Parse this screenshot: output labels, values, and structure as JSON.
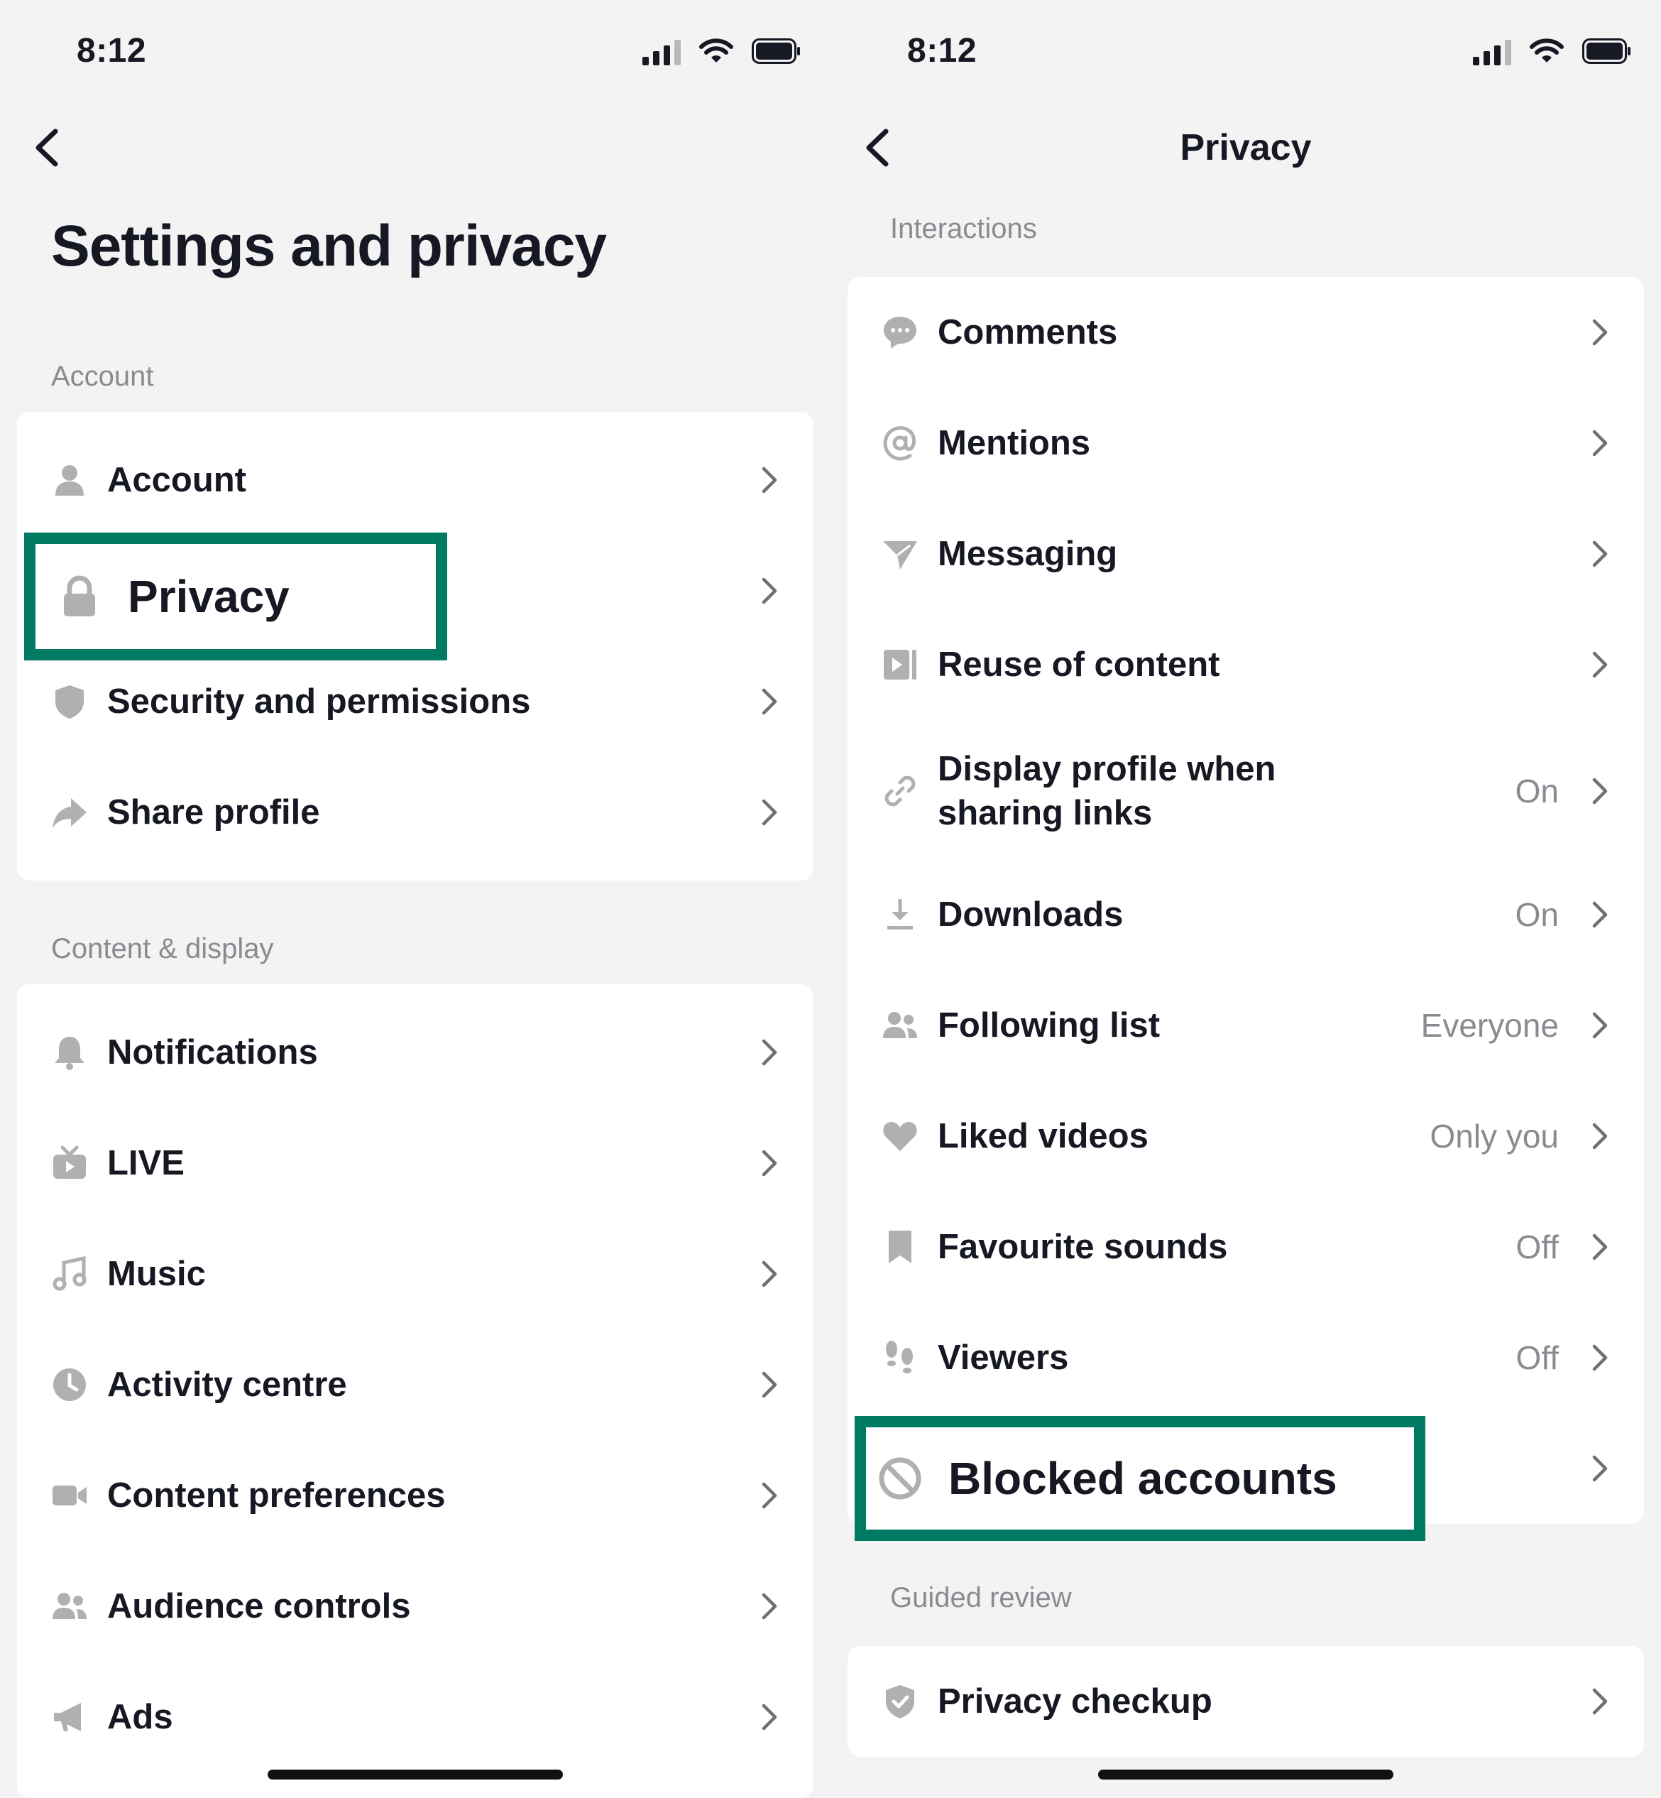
{
  "left_screen": {
    "status": {
      "time": "8:12"
    },
    "title": "Settings and privacy",
    "sections": [
      {
        "label": "Account",
        "items": [
          {
            "label": "Account",
            "icon": "person-icon"
          },
          {
            "label": "Privacy",
            "icon": "lock-icon"
          },
          {
            "label": "Security and permissions",
            "icon": "shield-icon"
          },
          {
            "label": "Share profile",
            "icon": "share-arrow-icon"
          }
        ]
      },
      {
        "label": "Content & display",
        "items": [
          {
            "label": "Notifications",
            "icon": "bell-icon"
          },
          {
            "label": "LIVE",
            "icon": "tv-icon"
          },
          {
            "label": "Music",
            "icon": "music-note-icon"
          },
          {
            "label": "Activity centre",
            "icon": "clock-icon"
          },
          {
            "label": "Content preferences",
            "icon": "video-camera-icon"
          },
          {
            "label": "Audience controls",
            "icon": "people-icon"
          },
          {
            "label": "Ads",
            "icon": "megaphone-icon"
          }
        ]
      }
    ]
  },
  "right_screen": {
    "status": {
      "time": "8:12"
    },
    "title": "Privacy",
    "sections": [
      {
        "label": "Interactions",
        "items": [
          {
            "label": "Comments",
            "value": "",
            "icon": "comment-bubble-icon"
          },
          {
            "label": "Mentions",
            "value": "",
            "icon": "at-sign-icon"
          },
          {
            "label": "Messaging",
            "value": "",
            "icon": "paper-plane-icon"
          },
          {
            "label": "Reuse of content",
            "value": "",
            "icon": "play-square-icon"
          },
          {
            "label": "Display profile when sharing links",
            "value": "On",
            "icon": "link-icon"
          },
          {
            "label": "Downloads",
            "value": "On",
            "icon": "download-icon"
          },
          {
            "label": "Following list",
            "value": "Everyone",
            "icon": "people-icon"
          },
          {
            "label": "Liked videos",
            "value": "Only you",
            "icon": "heart-icon"
          },
          {
            "label": "Favourite sounds",
            "value": "Off",
            "icon": "bookmark-icon"
          },
          {
            "label": "Viewers",
            "value": "Off",
            "icon": "footprints-icon"
          },
          {
            "label": "Blocked accounts",
            "value": "",
            "icon": "block-icon"
          }
        ]
      },
      {
        "label": "Guided review",
        "items": [
          {
            "label": "Privacy checkup",
            "value": "",
            "icon": "shield-check-icon"
          }
        ]
      }
    ]
  },
  "colors": {
    "highlight_border": "#007a62",
    "background": "#f3f3f3",
    "card": "#ffffff",
    "secondary_text": "#8a8b91",
    "icon_gray": "#b0b0b3"
  }
}
